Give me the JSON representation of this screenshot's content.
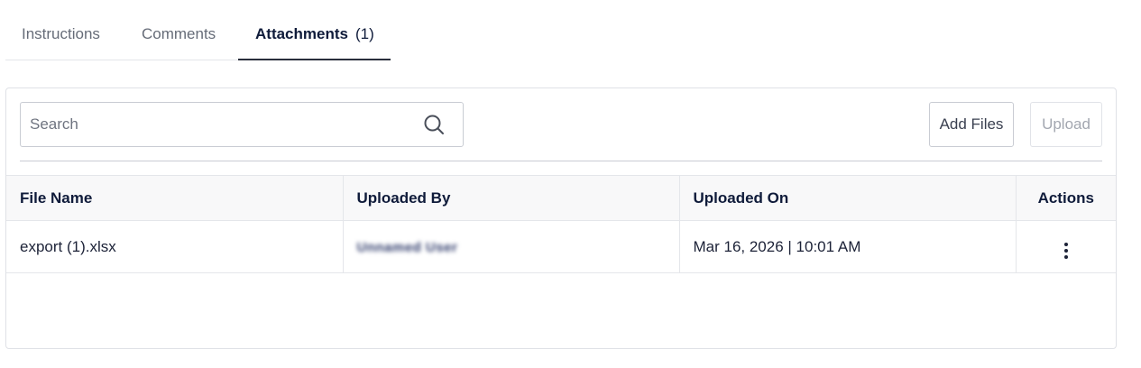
{
  "tabs": [
    {
      "label": "Instructions",
      "active": false
    },
    {
      "label": "Comments",
      "active": false
    },
    {
      "label": "Attachments",
      "count": "(1)",
      "active": true
    }
  ],
  "toolbar": {
    "search_placeholder": "Search",
    "search_value": "",
    "add_files_label": "Add Files",
    "upload_label": "Upload",
    "upload_enabled": false
  },
  "table": {
    "columns": [
      "File Name",
      "Uploaded By",
      "Uploaded On",
      "Actions"
    ],
    "rows": [
      {
        "file_name": "export (1).xlsx",
        "uploaded_by": "Unnamed User",
        "uploaded_on": "Mar 16, 2026 | 10:01 AM"
      }
    ]
  },
  "icons": {
    "search": "search-icon",
    "actions": "more-vertical-icon"
  },
  "colors": {
    "text_dark": "#0f1b3a",
    "tab_inactive": "#666c78",
    "border": "#dfe1e6",
    "header_bg": "#f8f8f9",
    "disabled_text": "#a3a7b0"
  }
}
